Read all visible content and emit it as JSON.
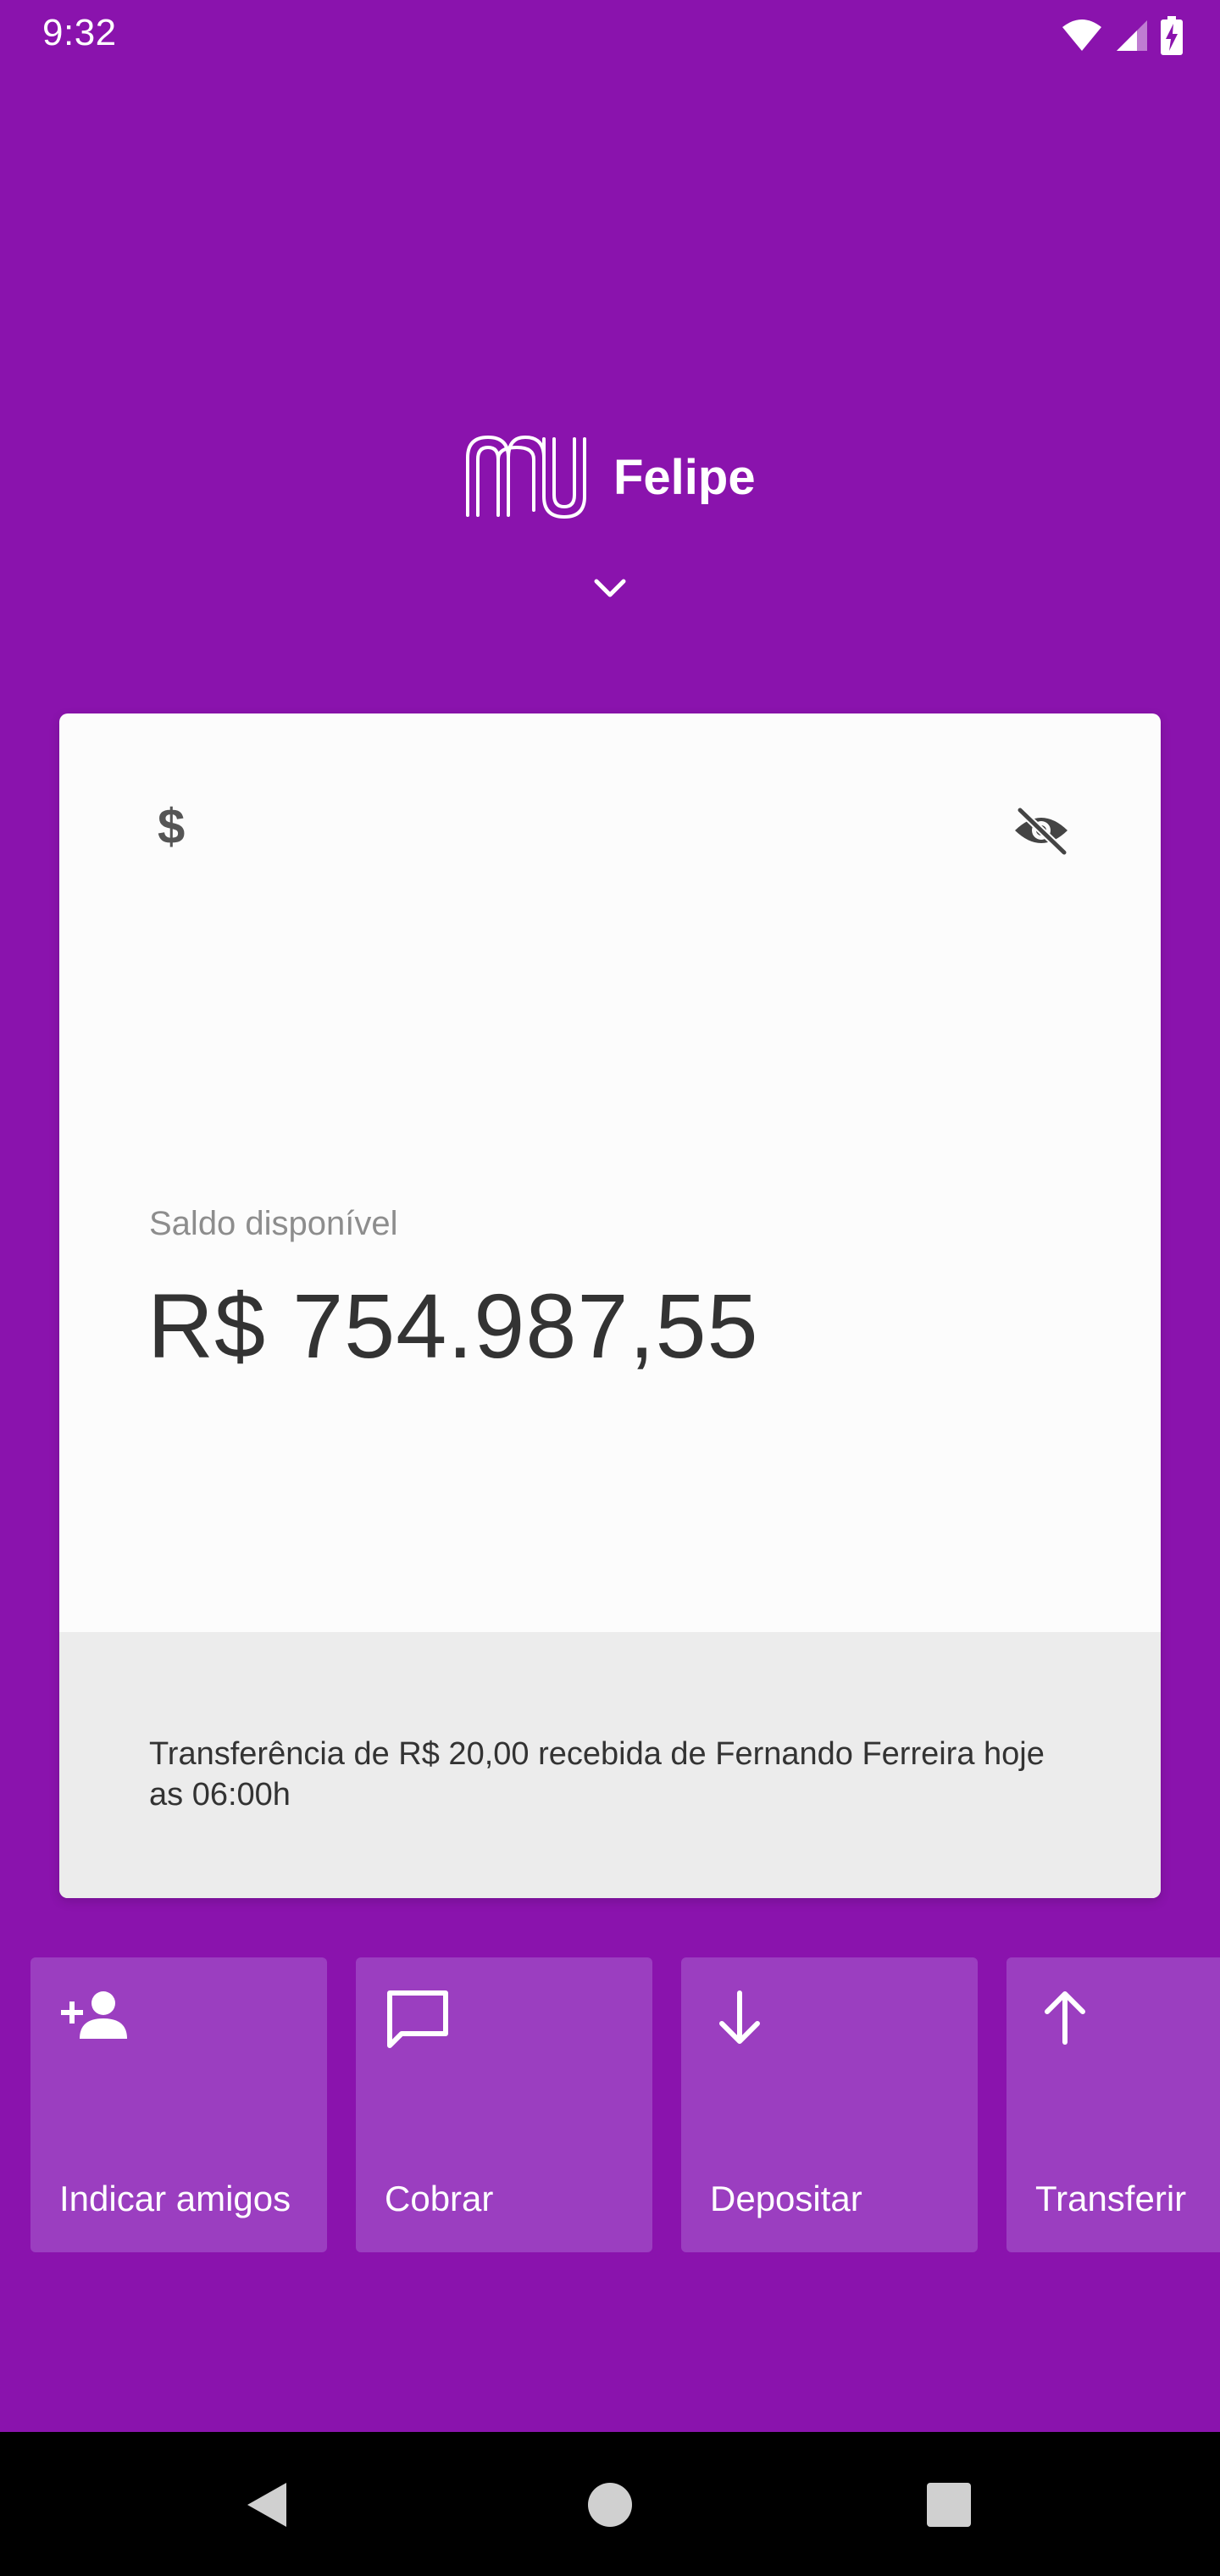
{
  "status_bar": {
    "time": "9:32",
    "icons": [
      "wifi-icon",
      "cellular-signal-icon",
      "battery-charging-icon"
    ]
  },
  "header": {
    "logo": "nu",
    "account_name": "Felipe",
    "chevron_icon": "chevron-down-icon"
  },
  "card": {
    "dollar_icon": "$",
    "visibility_icon": "eye-off-icon",
    "balance_label": "Saldo disponível",
    "balance_value": "R$ 754.987,55",
    "notice": "Transferência de R$ 20,00 recebida de Fernando Ferreira hoje as 06:00h"
  },
  "shortcuts": [
    {
      "label": "Indicar amigos",
      "icon": "person-add-icon"
    },
    {
      "label": "Cobrar",
      "icon": "chat-bubble-icon"
    },
    {
      "label": "Depositar",
      "icon": "arrow-down-icon"
    },
    {
      "label": "Transferir",
      "icon": "arrow-up-icon"
    }
  ],
  "colors": {
    "background": "#8a13ad",
    "card": "#fcfcfc",
    "card_footer": "#ececec",
    "shortcut_tile": "#9b3ec0"
  }
}
